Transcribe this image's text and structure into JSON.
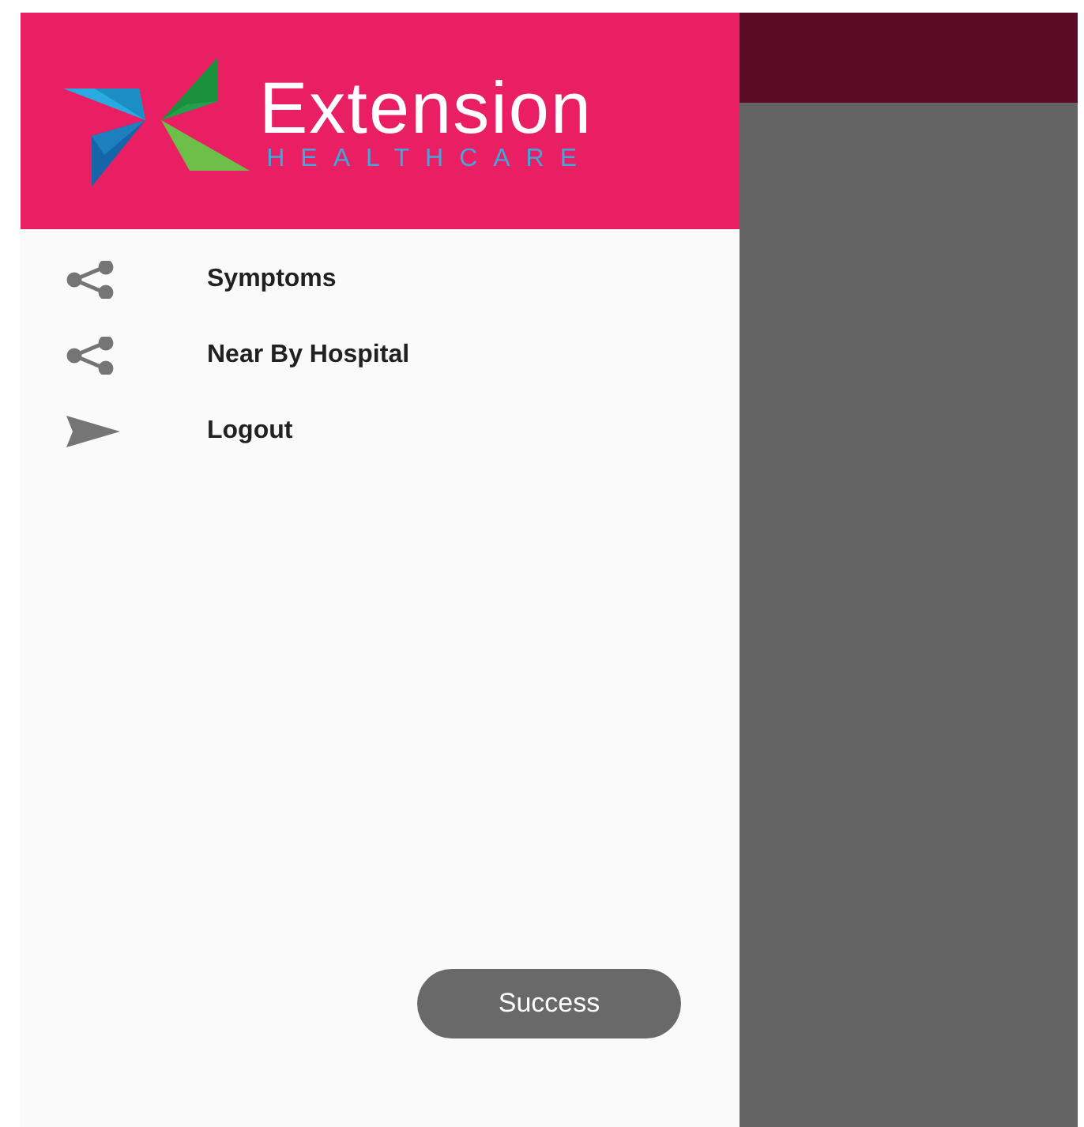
{
  "header": {
    "logo_title": "Extension",
    "logo_subtitle": "HEALTHCARE"
  },
  "menu_items": [
    {
      "kind": "share",
      "label": "Symptoms"
    },
    {
      "kind": "share",
      "label": "Near By Hospital"
    },
    {
      "kind": "send",
      "label": "Logout"
    }
  ],
  "toast": "Success"
}
